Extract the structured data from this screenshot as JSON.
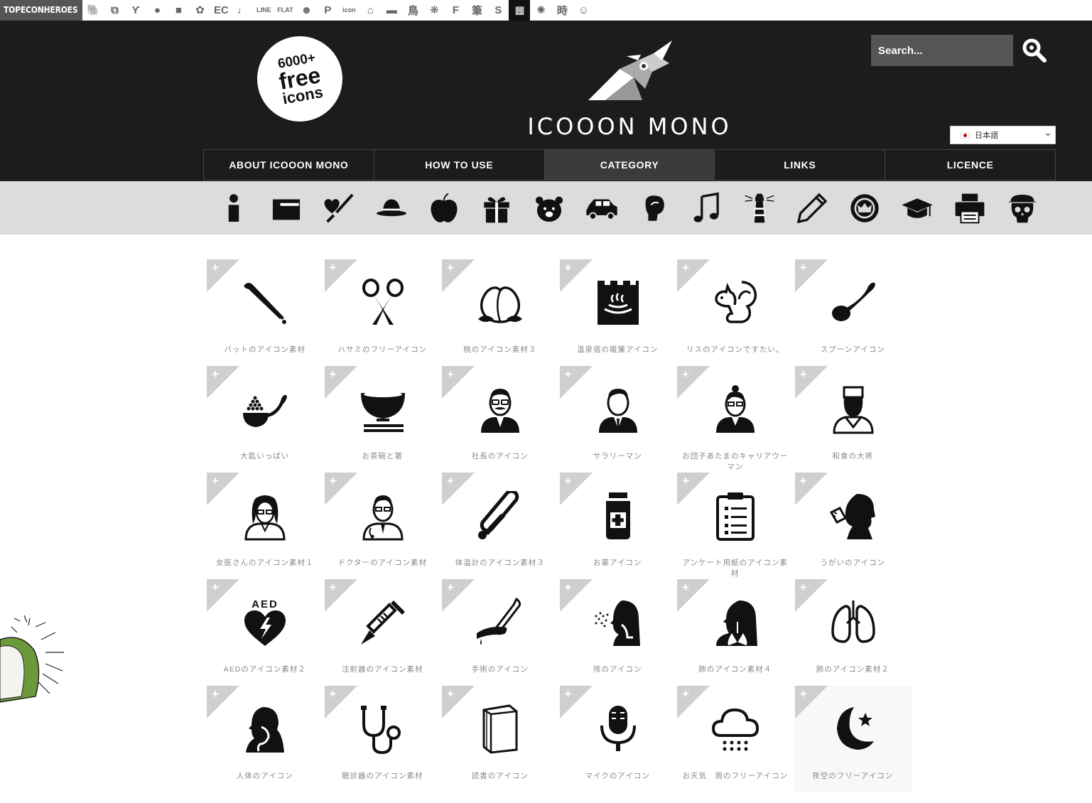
{
  "topbar": {
    "brand": "TOPECONHEROES",
    "sites": [
      {
        "glyph": "🐘",
        "name": "animal-icon"
      },
      {
        "glyph": "⧉",
        "name": "copy-icon"
      },
      {
        "glyph": "Ƴ",
        "name": "person-jump-icon"
      },
      {
        "glyph": "●",
        "name": "chat-bubble-icon"
      },
      {
        "glyph": "■",
        "name": "book-icon"
      },
      {
        "glyph": "✿",
        "name": "flower-icon"
      },
      {
        "glyph": "EC",
        "name": "ec-text-icon"
      },
      {
        "glyph": "♩",
        "name": "music-note-icon"
      },
      {
        "glyph": "LINE",
        "name": "line-text-icon"
      },
      {
        "glyph": "FLAT",
        "name": "flat-text-icon"
      },
      {
        "glyph": "☻",
        "name": "smiley-icon"
      },
      {
        "glyph": "P",
        "name": "parking-icon"
      },
      {
        "glyph": "icon",
        "name": "icon-text-icon"
      },
      {
        "glyph": "⌂",
        "name": "building-icon"
      },
      {
        "glyph": "▬",
        "name": "bed-icon"
      },
      {
        "glyph": "鳥",
        "name": "bird-kanji-icon"
      },
      {
        "glyph": "❋",
        "name": "pattern-icon"
      },
      {
        "glyph": "F",
        "name": "f-letter-icon"
      },
      {
        "glyph": "筆",
        "name": "brush-kanji-icon"
      },
      {
        "glyph": "S",
        "name": "s-letter-icon"
      },
      {
        "glyph": "▦",
        "name": "grid-icon"
      },
      {
        "glyph": "✺",
        "name": "burst-icon"
      },
      {
        "glyph": "時",
        "name": "time-kanji-icon"
      },
      {
        "glyph": "☺",
        "name": "face-icon"
      }
    ]
  },
  "header": {
    "badge": {
      "line1": "6000+",
      "line2": "free",
      "line3": "icons"
    },
    "title": "ICOOON MONO",
    "search_placeholder": "Search...",
    "language": "日本語"
  },
  "nav": [
    {
      "label": "ABOUT ICOOON MONO"
    },
    {
      "label": "HOW TO USE"
    },
    {
      "label": "CATEGORY",
      "active": true
    },
    {
      "label": "LINKS"
    },
    {
      "label": "LICENCE"
    }
  ],
  "categories": [
    "person-icon",
    "folder-icon",
    "medical-icon",
    "hat-icon",
    "apple-icon",
    "gift-icon",
    "bear-icon",
    "car-icon",
    "boxing-icon",
    "music-icon",
    "lighthouse-icon",
    "pencil-icon",
    "crown-badge-icon",
    "graduation-cap-icon",
    "printer-icon",
    "skull-icon"
  ],
  "icons": [
    {
      "label": "バットのアイコン素材",
      "icon": "bat-icon"
    },
    {
      "label": "ハサミのフリーアイコン",
      "icon": "scissors-icon"
    },
    {
      "label": "桃のアイコン素材３",
      "icon": "peach-icon"
    },
    {
      "label": "温泉宿の暖簾アイコン",
      "icon": "hot-spring-curtain-icon"
    },
    {
      "label": "リスのアイコンですたい。",
      "icon": "squirrel-icon"
    },
    {
      "label": "スプーンアイコン",
      "icon": "spoon-icon"
    },
    {
      "label": "大匙いっぱい",
      "icon": "tablespoon-icon"
    },
    {
      "label": "お茶碗と箸",
      "icon": "rice-bowl-icon"
    },
    {
      "label": "社長のアイコン",
      "icon": "president-icon"
    },
    {
      "label": "サラリーマン",
      "icon": "salaryman-icon"
    },
    {
      "label": "お団子あたまのキャリアウーマン",
      "icon": "career-woman-icon"
    },
    {
      "label": "和食の大将",
      "icon": "chef-icon"
    },
    {
      "label": "女医さんのアイコン素材１",
      "icon": "female-doctor-icon"
    },
    {
      "label": "ドクターのアイコン素材",
      "icon": "doctor-icon"
    },
    {
      "label": "体温計のアイコン素材３",
      "icon": "thermometer-icon"
    },
    {
      "label": "お薬アイコン",
      "icon": "medicine-bottle-icon"
    },
    {
      "label": "アンケート用紙のアイコン素材",
      "icon": "clipboard-icon"
    },
    {
      "label": "うがいのアイコン",
      "icon": "gargle-icon"
    },
    {
      "label": "AEDのアイコン素材２",
      "icon": "aed-icon"
    },
    {
      "label": "注射器のアイコン素材",
      "icon": "syringe-icon"
    },
    {
      "label": "手術のアイコン",
      "icon": "surgery-icon"
    },
    {
      "label": "咳のアイコン",
      "icon": "cough-icon"
    },
    {
      "label": "肺のアイコン素材４",
      "icon": "lungs-person-icon"
    },
    {
      "label": "肺のアイコン素材２",
      "icon": "lungs-icon"
    },
    {
      "label": "人体のアイコン",
      "icon": "human-body-icon"
    },
    {
      "label": "聴診器のアイコン素材",
      "icon": "stethoscope-icon"
    },
    {
      "label": "読書のアイコン",
      "icon": "book-reading-icon"
    },
    {
      "label": "マイクのアイコン",
      "icon": "microphone-icon"
    },
    {
      "label": "お天気　雨のフリーアイコン",
      "icon": "rain-cloud-icon"
    },
    {
      "label": "夜空のフリーアイコン",
      "icon": "night-sky-icon"
    }
  ],
  "aed_text": "AED",
  "plus_symbol": "+",
  "colors": {
    "header_bg": "#1c1c1d",
    "nav_active": "#3b3b3b",
    "catbar_bg": "#dcdcdc",
    "corner": "#cfcfcf",
    "label": "#888888"
  }
}
